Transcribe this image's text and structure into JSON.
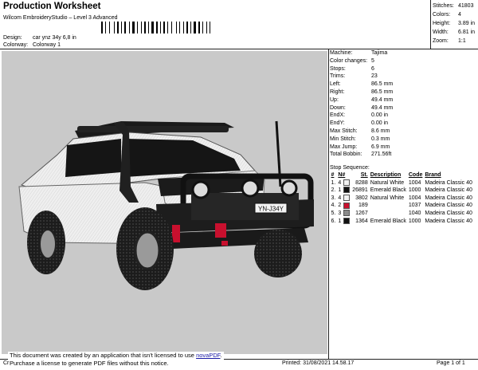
{
  "header": {
    "title": "Production Worksheet",
    "subtitle": "Wilcom EmbroideryStudio – Level 3 Advanced",
    "design_label": "Design:",
    "design_value": "car ynz 34y 6,8 in",
    "colorway_label": "Colorway:",
    "colorway_value": "Colorway 1"
  },
  "stats": [
    {
      "label": "Stitches:",
      "value": "41803"
    },
    {
      "label": "Colors:",
      "value": "4"
    },
    {
      "label": "Height:",
      "value": "3.89 in"
    },
    {
      "label": "Width:",
      "value": "6.81 in"
    },
    {
      "label": "Zoom:",
      "value": "1:1"
    }
  ],
  "props": [
    {
      "label": "Machine:",
      "value": "Tajima"
    },
    {
      "label": "Color changes:",
      "value": "5"
    },
    {
      "label": "Stops:",
      "value": "6"
    },
    {
      "label": "Trims:",
      "value": "23"
    },
    {
      "label": "Left:",
      "value": "86.5 mm"
    },
    {
      "label": "Right:",
      "value": "86.5 mm"
    },
    {
      "label": "Up:",
      "value": "49.4 mm"
    },
    {
      "label": "Down:",
      "value": "49.4 mm"
    },
    {
      "label": "EndX:",
      "value": "0.00 in"
    },
    {
      "label": "EndY:",
      "value": "0.00 in"
    },
    {
      "label": "Max Stitch:",
      "value": "8.6 mm"
    },
    {
      "label": "Min Stitch:",
      "value": "0.3 mm"
    },
    {
      "label": "Max Jump:",
      "value": "6.9 mm"
    },
    {
      "label": "Total Bobbin:",
      "value": "271.56ft"
    }
  ],
  "stop_sequence": {
    "title": "Stop Sequence:",
    "headers": [
      "#",
      "N#",
      "St.",
      "Description",
      "Code",
      "Brand"
    ],
    "rows": [
      {
        "num": "1.",
        "n": "4",
        "color": "#f2f2f2",
        "st": "8288",
        "desc": "Natural White",
        "code": "1004",
        "brand": "Madeira Classic 40"
      },
      {
        "num": "2.",
        "n": "1",
        "color": "#111111",
        "st": "26891",
        "desc": "Emerald Black",
        "code": "1000",
        "brand": "Madeira Classic 40"
      },
      {
        "num": "3.",
        "n": "4",
        "color": "#f2f2f2",
        "st": "3802",
        "desc": "Natural White",
        "code": "1004",
        "brand": "Madeira Classic 40"
      },
      {
        "num": "4.",
        "n": "2",
        "color": "#c8102e",
        "st": "189",
        "desc": "",
        "code": "1037",
        "brand": "Madeira Classic 40"
      },
      {
        "num": "5.",
        "n": "3",
        "color": "#8a8a8a",
        "st": "1267",
        "desc": "",
        "code": "1040",
        "brand": "Madeira Classic 40"
      },
      {
        "num": "6.",
        "n": "1",
        "color": "#111111",
        "st": "1364",
        "desc": "Emerald Black",
        "code": "1000",
        "brand": "Madeira Classic 40"
      }
    ]
  },
  "design": {
    "plate_text": "YN-J34Y"
  },
  "notice": {
    "line1_pre": "This document was created by an application that isn't licensed to use ",
    "line1_link": "novaPDF",
    "line1_post": ".",
    "line2": "Purchase a license to generate PDF files without this notice."
  },
  "footer": {
    "left": "Cr",
    "printed": "Printed: 31/08/2021 14.58.17",
    "page": "Page 1 of 1"
  }
}
